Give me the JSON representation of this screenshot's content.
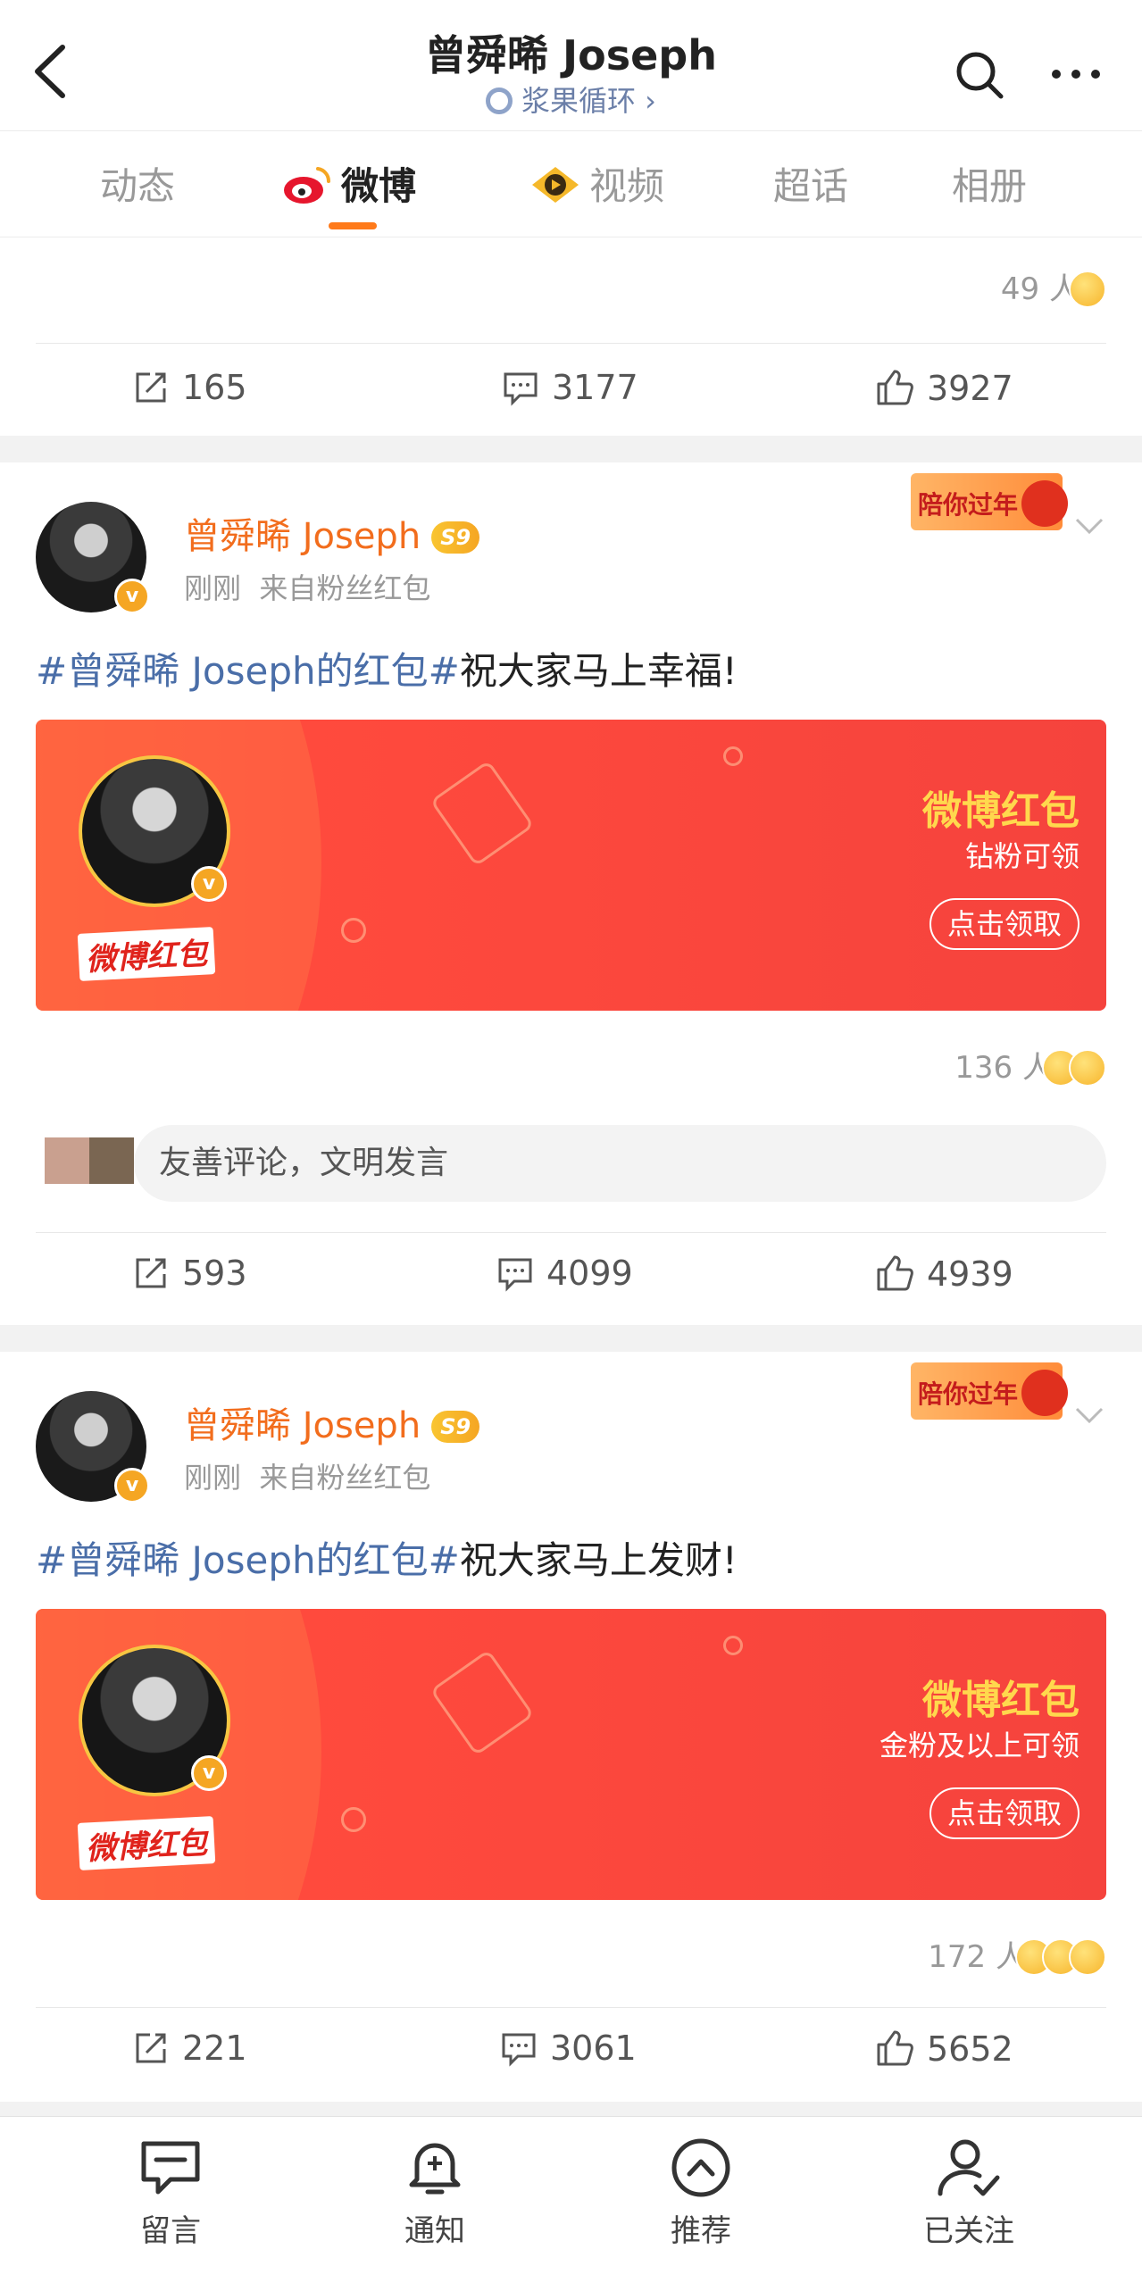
{
  "header": {
    "title": "曾舜晞 Joseph",
    "subtitle": "浆果循环 ›"
  },
  "tabs": [
    {
      "label": "动态"
    },
    {
      "label": "微博"
    },
    {
      "label": "视频"
    },
    {
      "label": "超话"
    },
    {
      "label": "相册"
    }
  ],
  "top_card": {
    "reaction_count": "49 人",
    "reposts": "165",
    "comments": "3177",
    "likes": "3927"
  },
  "posts": [
    {
      "author": "曾舜晞 Joseph",
      "level": "S9",
      "badge_text": "陪你过年",
      "time": "刚刚",
      "source": "来自粉丝红包",
      "topic": "#曾舜晞 Joseph的红包#",
      "text": "祝大家马上幸福!",
      "redpack_logo": "微博红包",
      "redpack_title": "微博红包",
      "redpack_sub": "钻粉可领",
      "redpack_btn": "点击领取",
      "reaction_count": "136 人",
      "comment_placeholder": "友善评论，文明发言",
      "reposts": "593",
      "comments": "4099",
      "likes": "4939"
    },
    {
      "author": "曾舜晞 Joseph",
      "level": "S9",
      "badge_text": "陪你过年",
      "time": "刚刚",
      "source": "来自粉丝红包",
      "topic": "#曾舜晞 Joseph的红包#",
      "text": "祝大家马上发财!",
      "redpack_logo": "微博红包",
      "redpack_title": "微博红包",
      "redpack_sub": "金粉及以上可领",
      "redpack_btn": "点击领取",
      "reaction_count": "172 人",
      "reposts": "221",
      "comments": "3061",
      "likes": "5652"
    }
  ],
  "bottom_nav": [
    {
      "label": "留言",
      "icon": "message-icon"
    },
    {
      "label": "通知",
      "icon": "bell-plus-icon"
    },
    {
      "label": "推荐",
      "icon": "chevron-up-circle-icon"
    },
    {
      "label": "已关注",
      "icon": "user-check-icon"
    }
  ],
  "colors": {
    "accent": "#ff7a1a",
    "username": "#f26d1d",
    "topic": "#4a6ea8",
    "redpack": "#f5433d"
  }
}
